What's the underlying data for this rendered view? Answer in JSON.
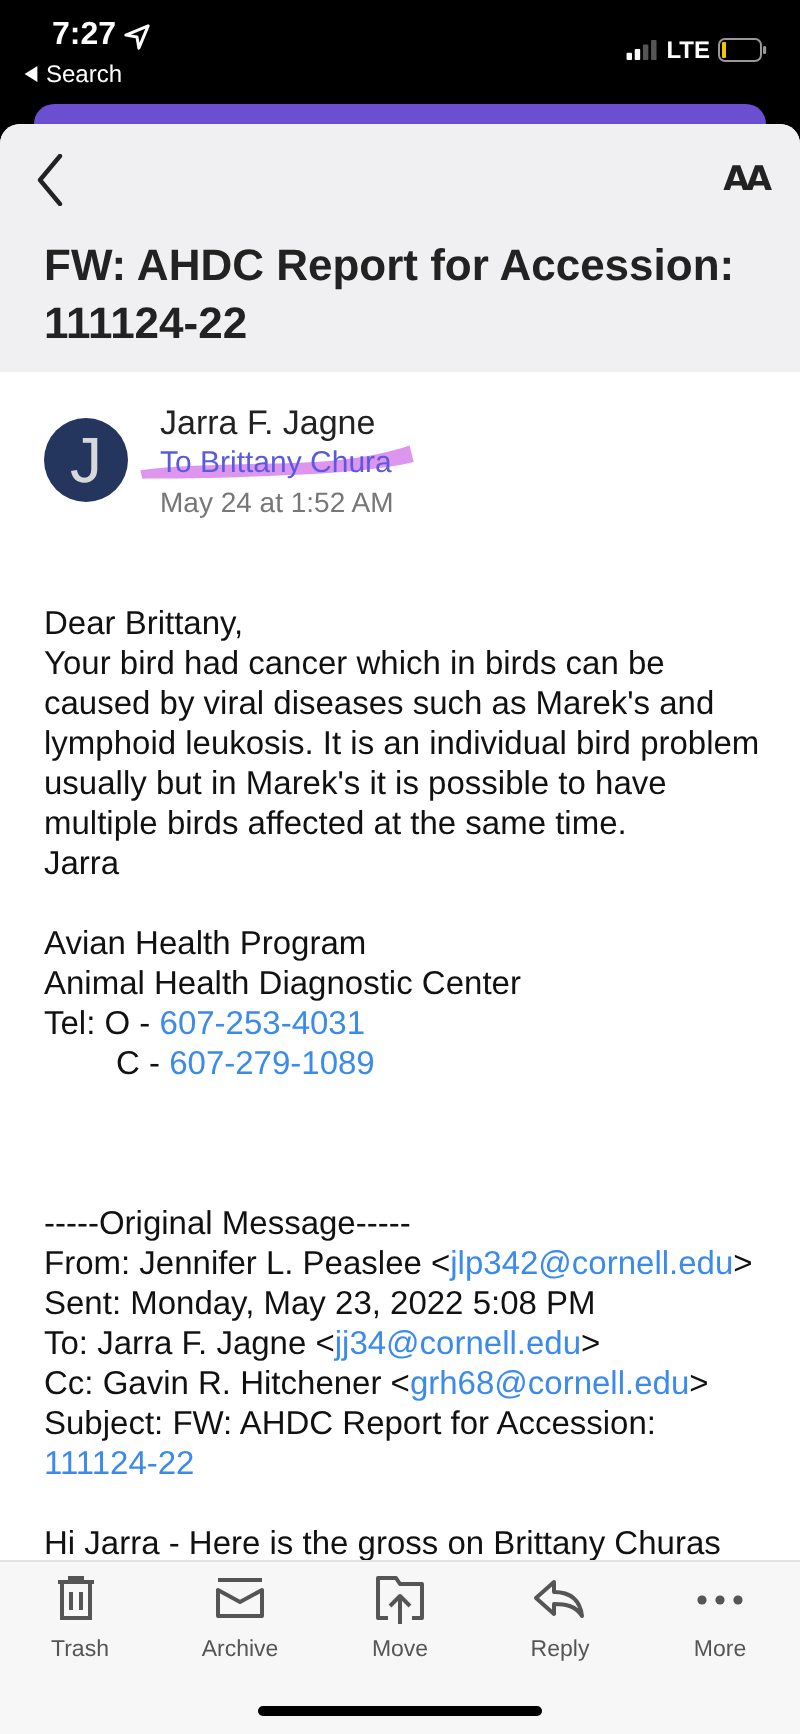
{
  "status_bar": {
    "time": "7:27",
    "back_label": "Search",
    "network": "LTE"
  },
  "header": {
    "text_size_label": "AA",
    "title": "FW: AHDC Report for Accession: 111124-22"
  },
  "message": {
    "avatar_letter": "J",
    "sender": "Jarra F. Jagne",
    "recipient": "To Brittany Chura",
    "date": "May 24 at 1:52 AM",
    "body": [
      {
        "kind": "text",
        "segments": [
          {
            "text": "Dear Brittany,",
            "link": false
          }
        ]
      },
      {
        "kind": "text",
        "segments": [
          {
            "text": "Your bird had cancer which in birds can be caused by viral diseases such as Marek's and lymphoid leukosis. It is an individual bird problem usually but in Marek's it is possible to have multiple birds affected at the same time.",
            "link": false
          }
        ]
      },
      {
        "kind": "text",
        "segments": [
          {
            "text": "Jarra",
            "link": false
          }
        ]
      },
      {
        "kind": "blank"
      },
      {
        "kind": "text",
        "segments": [
          {
            "text": "Avian Health Program",
            "link": false
          }
        ]
      },
      {
        "kind": "text",
        "segments": [
          {
            "text": "Animal Health Diagnostic Center",
            "link": false
          }
        ]
      },
      {
        "kind": "text",
        "segments": [
          {
            "text": "Tel: O - ",
            "link": false
          },
          {
            "text": "607-253-4031",
            "link": true
          }
        ]
      },
      {
        "kind": "indented",
        "segments": [
          {
            "text": "C - ",
            "link": false
          },
          {
            "text": "607-279-1089",
            "link": true
          }
        ]
      },
      {
        "kind": "blank"
      },
      {
        "kind": "blank"
      },
      {
        "kind": "blank"
      },
      {
        "kind": "text",
        "segments": [
          {
            "text": "-----Original Message-----",
            "link": false
          }
        ]
      },
      {
        "kind": "text",
        "segments": [
          {
            "text": "From: Jennifer L. Peaslee <",
            "link": false
          },
          {
            "text": "jlp342@cornell.edu",
            "link": true
          },
          {
            "text": ">",
            "link": false
          }
        ]
      },
      {
        "kind": "text",
        "segments": [
          {
            "text": "Sent: Monday, May 23, 2022 5:08 PM",
            "link": false
          }
        ]
      },
      {
        "kind": "text",
        "segments": [
          {
            "text": "To: Jarra F. Jagne <",
            "link": false
          },
          {
            "text": "jj34@cornell.edu",
            "link": true
          },
          {
            "text": ">",
            "link": false
          }
        ]
      },
      {
        "kind": "text",
        "segments": [
          {
            "text": "Cc: Gavin R. Hitchener <",
            "link": false
          },
          {
            "text": "grh68@cornell.edu",
            "link": true
          },
          {
            "text": ">",
            "link": false
          }
        ]
      },
      {
        "kind": "text",
        "segments": [
          {
            "text": "Subject: FW: AHDC Report for Accession:",
            "link": false
          }
        ]
      },
      {
        "kind": "text",
        "segments": [
          {
            "text": "111124-22",
            "link": true
          }
        ]
      },
      {
        "kind": "blank"
      },
      {
        "kind": "text",
        "segments": [
          {
            "text": "Hi Jarra - Here is the gross on Brittany Churas",
            "link": false
          }
        ]
      }
    ]
  },
  "toolbar": [
    {
      "kind": "trash",
      "label": "Trash"
    },
    {
      "kind": "archive",
      "label": "Archive"
    },
    {
      "kind": "move",
      "label": "Move"
    },
    {
      "kind": "reply",
      "label": "Reply"
    },
    {
      "kind": "more",
      "label": "More"
    }
  ]
}
